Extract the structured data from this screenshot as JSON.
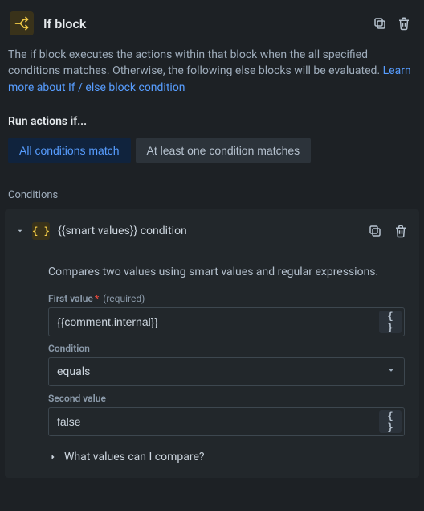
{
  "header": {
    "title": "If block",
    "icon": "branch-icon"
  },
  "description": {
    "text_before_link": "The if block executes the actions within that block when the all specified conditions matches. Otherwise, the following else blocks will be evaluated. ",
    "link_text": "Learn more about If / else block condition"
  },
  "run_actions_section": {
    "label": "Run actions if...",
    "options": {
      "all": "All conditions match",
      "one": "At least one condition matches"
    },
    "selected": "all"
  },
  "conditions_section": {
    "label": "Conditions"
  },
  "condition": {
    "title": "{{smart values}} condition",
    "description": "Compares two values using smart values and regular expressions.",
    "first_value": {
      "label": "First value",
      "required_marker": "*",
      "required_text": "(required)",
      "value": "{{comment.internal}}"
    },
    "condition_field": {
      "label": "Condition",
      "value": "equals"
    },
    "second_value": {
      "label": "Second value",
      "value": "false"
    },
    "help": "What values can I compare?"
  },
  "glyphs": {
    "braces": "{ }"
  }
}
